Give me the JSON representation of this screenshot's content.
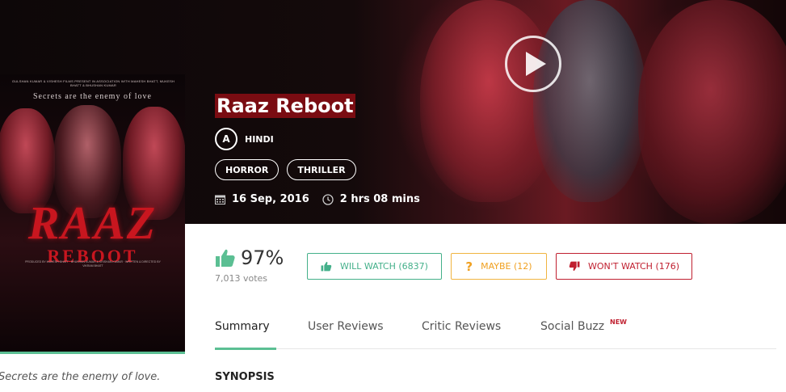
{
  "hero": {
    "play_icon": "play-icon"
  },
  "poster": {
    "credits_top": "GULSHAN KUMAR & VISHESH FILMS PRESENT IN ASSOCIATION WITH MAHESH BHATT, MUKESH BHATT & BHUSHAN KUMAR",
    "tagline": "Secrets are the enemy of love",
    "title": "RAAZ",
    "subtitle": "REBOOT",
    "credits_bottom": "PRODUCED BY MUKESH BHATT · BHUSHAN KUMAR & KRISHAN KUMAR · WRITTEN & DIRECTED BY VIKRAM BHATT",
    "caption": "Secrets are the enemy of love."
  },
  "movie": {
    "title": "Raaz Reboot",
    "certificate": "A",
    "language": "HINDI",
    "genres": [
      "HORROR",
      "THRILLER"
    ],
    "release_date": "16 Sep, 2016",
    "duration": "2 hrs 08 mins"
  },
  "rating": {
    "percent": "97%",
    "votes": "7,013 votes",
    "accent_color": "#5bbf93"
  },
  "actions": {
    "will_watch": "WILL WATCH (6837)",
    "maybe": "MAYBE (12)",
    "wont_watch": "WON'T WATCH (176)",
    "will_color": "#44b08a",
    "maybe_color": "#f0a020",
    "wont_color": "#c02030"
  },
  "tabs": {
    "summary": "Summary",
    "user_reviews": "User Reviews",
    "critic_reviews": "Critic Reviews",
    "social_buzz": "Social Buzz",
    "new_badge": "NEW"
  },
  "sections": {
    "synopsis": "SYNOPSIS"
  }
}
